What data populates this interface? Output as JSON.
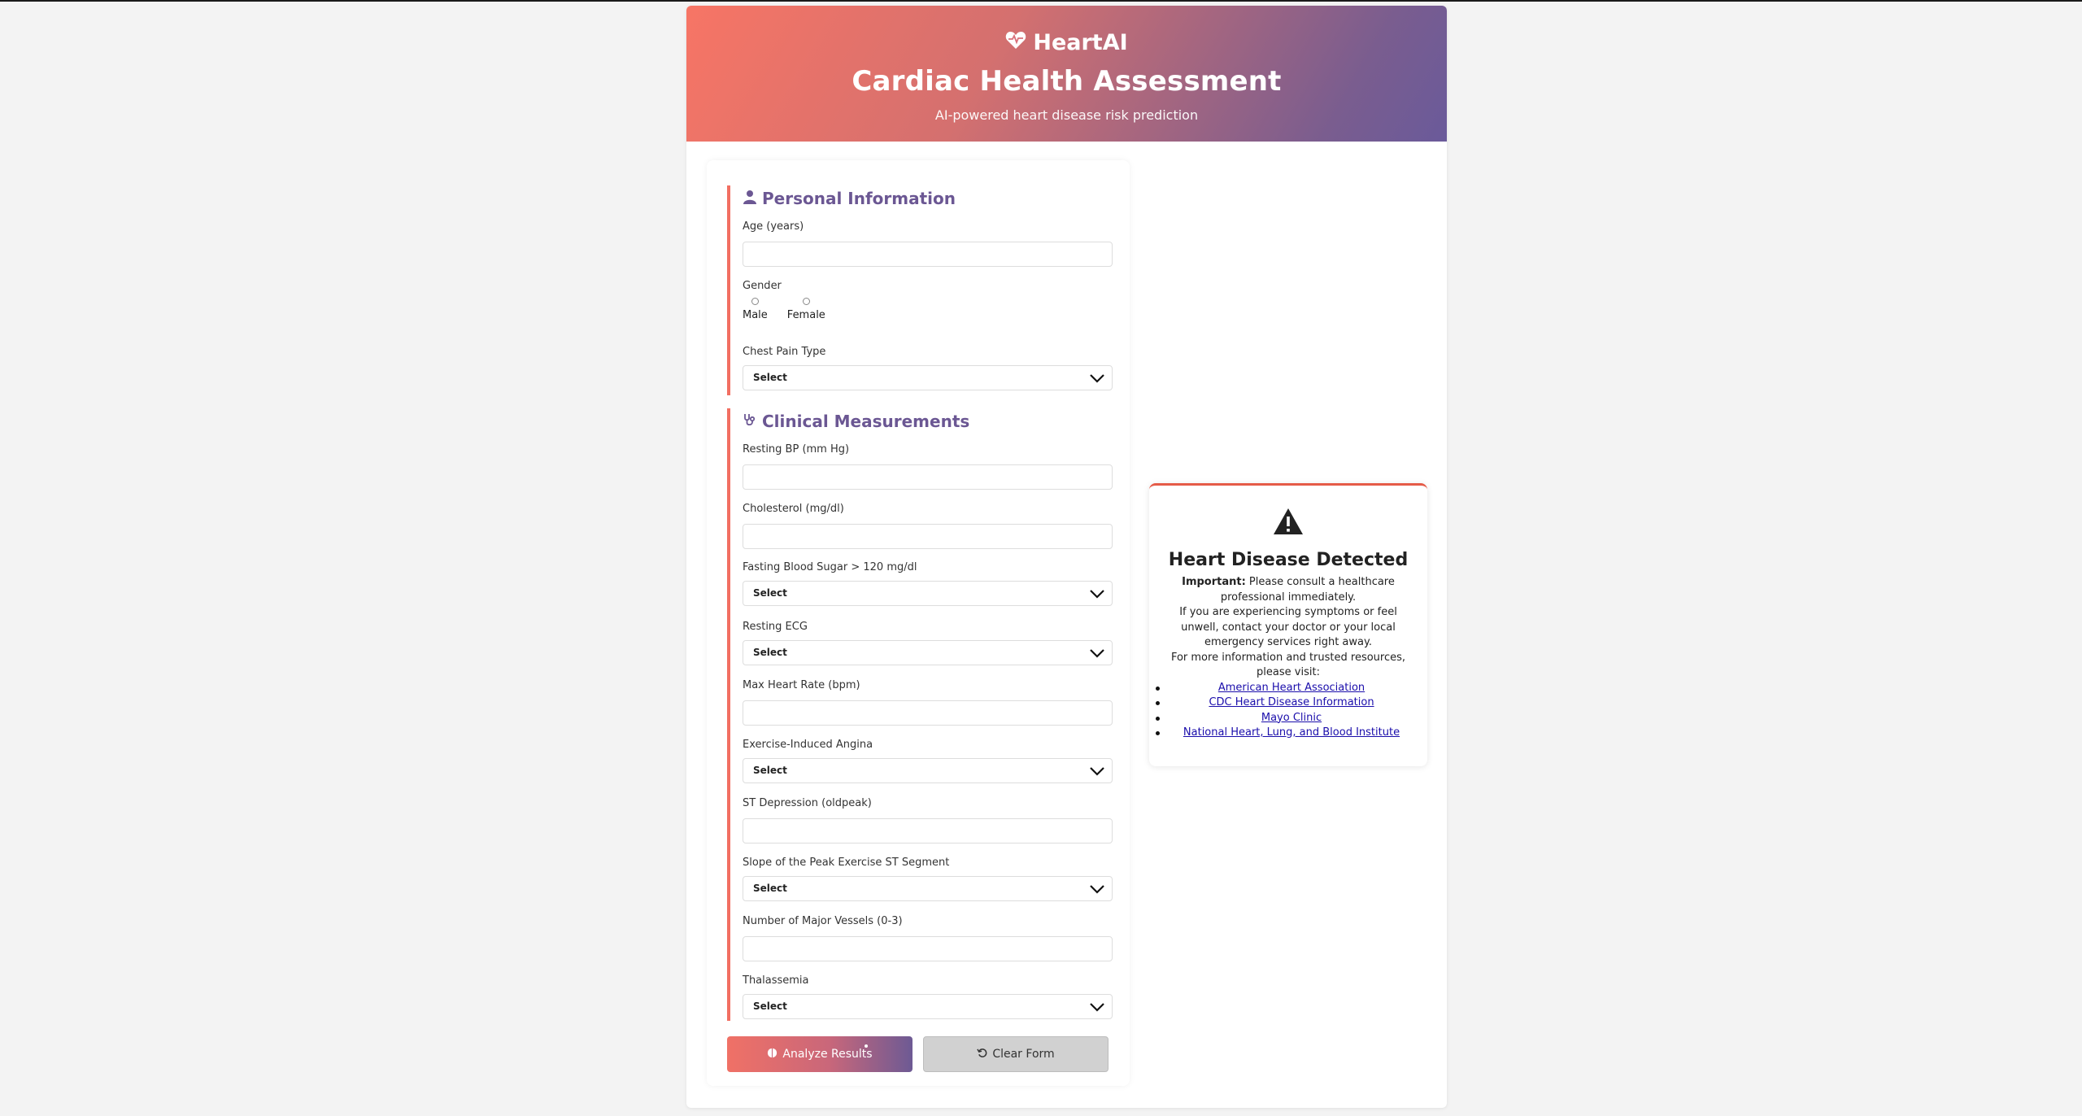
{
  "header": {
    "brand": "HeartAI",
    "title": "Cardiac Health Assessment",
    "subtitle": "AI-powered heart disease risk prediction"
  },
  "personal": {
    "title": "Personal Information",
    "age_label": "Age (years)",
    "age_value": "",
    "gender_label": "Gender",
    "gender_options": [
      "Male",
      "Female"
    ],
    "chest_pain_label": "Chest Pain Type",
    "chest_pain_value": "Select"
  },
  "clinical": {
    "title": "Clinical Measurements",
    "resting_bp_label": "Resting BP (mm Hg)",
    "cholesterol_label": "Cholesterol (mg/dl)",
    "fbs_label": "Fasting Blood Sugar > 120 mg/dl",
    "fbs_value": "Select",
    "ecg_label": "Resting ECG",
    "ecg_value": "Select",
    "max_hr_label": "Max Heart Rate (bpm)",
    "angina_label": "Exercise-Induced Angina",
    "angina_value": "Select",
    "st_dep_label": "ST Depression (oldpeak)",
    "slope_label": "Slope of the Peak Exercise ST Segment",
    "slope_value": "Select",
    "vessels_label": "Number of Major Vessels (0-3)",
    "thal_label": "Thalassemia",
    "thal_value": "Select"
  },
  "actions": {
    "analyze_label": "Analyze Results",
    "clear_label": "Clear Form"
  },
  "result": {
    "title": "Heart Disease Detected",
    "important_label": "Important:",
    "important_text": " Please consult a healthcare professional immediately.",
    "symptoms_text": "If you are experiencing symptoms or feel unwell, contact your doctor or your local emergency services right away.",
    "resources_intro": "For more information and trusted resources, please visit:",
    "links": [
      "American Heart Association",
      "CDC Heart Disease Information",
      "Mayo Clinic",
      "National Heart, Lung, and Blood Institute"
    ]
  },
  "colors": {
    "gradient_start": "#f77565",
    "gradient_end": "#6a5a9a",
    "section_accent": "#f26f62",
    "section_title": "#6b5793",
    "alert_border": "#e55b48"
  },
  "icons": {
    "brand": "heart-pulse-icon",
    "personal": "user-icon",
    "clinical": "stethoscope-icon",
    "select": "chevron-down-icon",
    "analyze": "brain-icon",
    "clear": "undo-icon",
    "alert": "warning-triangle-icon"
  }
}
